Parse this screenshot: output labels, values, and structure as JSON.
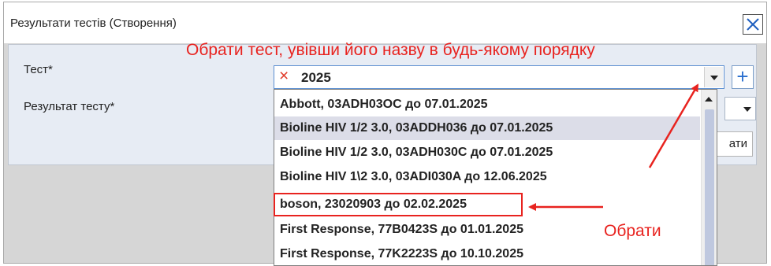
{
  "dialog": {
    "title": "Результати тестів (Створення)",
    "close_icon": "close-icon"
  },
  "form": {
    "test_label": "Тест*",
    "result_label": "Результат тесту*",
    "test_select": {
      "clear_icon": "clear-x-icon",
      "value": "2025"
    },
    "add_button": "+",
    "action_button_partial": "ати"
  },
  "dropdown": {
    "items": [
      {
        "label": "Abbott, 03ADH03OC до 07.01.2025",
        "highlighted": false
      },
      {
        "label": "Bioline HIV 1/2 3.0, 03ADDH036 до 07.01.2025",
        "highlighted": true
      },
      {
        "label": "Bioline HIV 1/2 3.0, 03ADH030C до 07.01.2025",
        "highlighted": false
      },
      {
        "label": "Bioline HIV 1\\2 3.0, 03ADI030A до 12.06.2025",
        "highlighted": false
      },
      {
        "label": "boson, 23020903 до 02.02.2025",
        "highlighted": false,
        "annotated": true
      },
      {
        "label": "First Response, 77B0423S до 01.01.2025",
        "highlighted": false
      },
      {
        "label": "First Response, 77K2223S до 10.10.2025",
        "highlighted": false
      }
    ]
  },
  "annotations": {
    "hint_text": "Обрати тест, увівши його назву в будь-якому порядку",
    "pick_text": "Обрати",
    "color": "#e8231f"
  }
}
